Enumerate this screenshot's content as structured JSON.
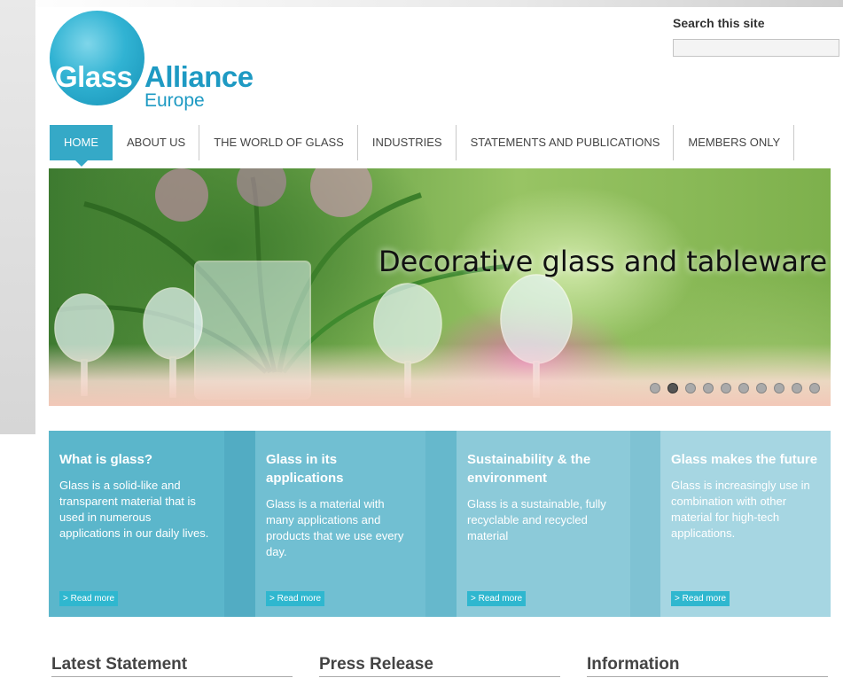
{
  "search": {
    "label": "Search this site",
    "value": "",
    "placeholder": ""
  },
  "logo": {
    "word1": "Glass",
    "word2": "Alliance",
    "word3": "Europe"
  },
  "nav": {
    "items": [
      {
        "label": "HOME",
        "active": true
      },
      {
        "label": "ABOUT US",
        "active": false
      },
      {
        "label": "THE WORLD OF GLASS",
        "active": false
      },
      {
        "label": "INDUSTRIES",
        "active": false
      },
      {
        "label": "STATEMENTS AND PUBLICATIONS",
        "active": false
      },
      {
        "label": "MEMBERS ONLY",
        "active": false
      }
    ]
  },
  "hero": {
    "title": "Decorative glass and tableware",
    "slide_count": 10,
    "active_slide": 2
  },
  "features": [
    {
      "title": "What is glass?",
      "text": "Glass is a solid-like and transparent material that is used in numerous applications in our daily lives.",
      "link": "> Read more",
      "color": "#5bb6cb"
    },
    {
      "title": "Glass in its applications",
      "text": "Glass is a material with many applications and products that we use every day.",
      "link": "> Read more",
      "color": "#71bfd2"
    },
    {
      "title": "Sustainability & the environment",
      "text": "Glass is a sustainable, fully recyclable and recycled material",
      "link": "> Read more",
      "color": "#8ccad9"
    },
    {
      "title": "Glass makes the future",
      "text": "Glass is increasingly use in combination with other material for high-tech applications.",
      "link": "> Read more",
      "color": "#a6d6e2"
    }
  ],
  "bottom": {
    "latest_statement": "Latest Statement",
    "press_release": "Press Release",
    "information": "Information"
  },
  "colors": {
    "accent": "#35a9c7",
    "logo_blue": "#1e9ac3",
    "feature_gap": "#52acc3"
  }
}
